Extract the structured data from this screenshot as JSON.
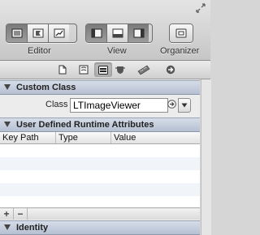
{
  "toolbar": {
    "editor_label": "Editor",
    "view_label": "View",
    "organizer_label": "Organizer"
  },
  "inspector_tabs": [
    "file",
    "quick-help",
    "identity",
    "attributes",
    "size",
    "connections"
  ],
  "custom_class": {
    "section_title": "Custom Class",
    "class_label": "Class",
    "class_value": "LTImageViewer"
  },
  "runtime_attributes": {
    "section_title": "User Defined Runtime Attributes",
    "columns": [
      "Key Path",
      "Type",
      "Value"
    ],
    "add_label": "+",
    "remove_label": "−"
  },
  "identity": {
    "section_title": "Identity"
  },
  "colors": {
    "section_header": "#c4ccdb",
    "selected_segment": "#8a8a8a"
  }
}
